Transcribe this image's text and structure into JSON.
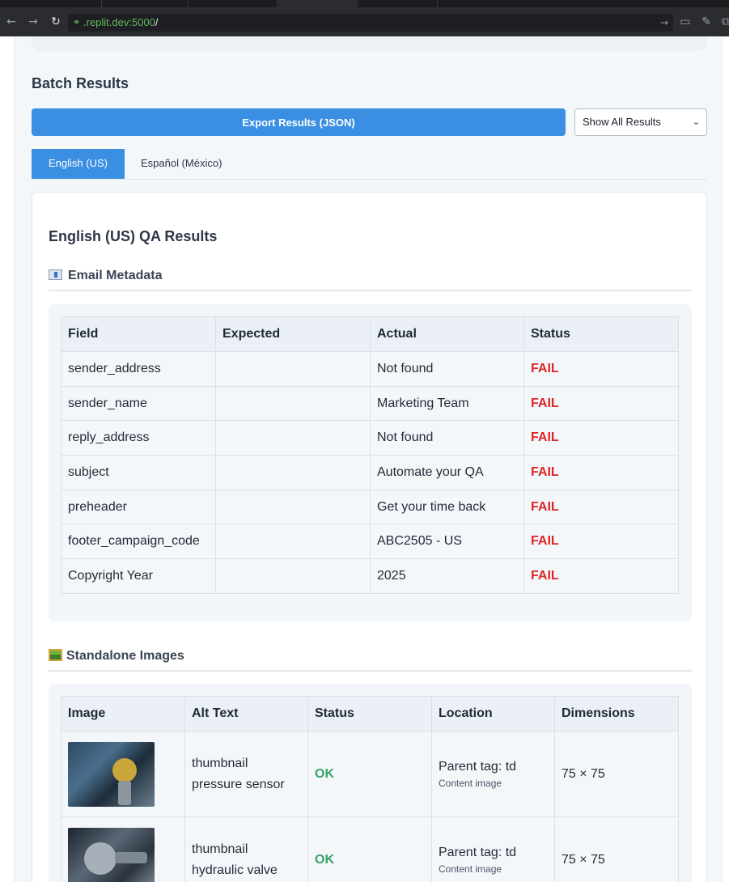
{
  "browser": {
    "url_host": ".replit.dev:5000",
    "url_path": "/"
  },
  "batch": {
    "title": "Batch Results",
    "export_label": "Export Results (JSON)",
    "filter_selected": "Show All Results",
    "tabs": [
      {
        "label": "English (US)",
        "active": true
      },
      {
        "label": "Español (México)",
        "active": false
      }
    ]
  },
  "results": {
    "title": "English (US) QA Results",
    "metadata": {
      "title": "Email Metadata",
      "headers": [
        "Field",
        "Expected",
        "Actual",
        "Status"
      ],
      "rows": [
        {
          "field": "sender_address",
          "expected": "",
          "actual": "Not found",
          "status": "FAIL"
        },
        {
          "field": "sender_name",
          "expected": "",
          "actual": "Marketing Team",
          "status": "FAIL"
        },
        {
          "field": "reply_address",
          "expected": "",
          "actual": "Not found",
          "status": "FAIL"
        },
        {
          "field": "subject",
          "expected": "",
          "actual": "Automate your QA",
          "status": "FAIL"
        },
        {
          "field": "preheader",
          "expected": "",
          "actual": "Get your time back",
          "status": "FAIL"
        },
        {
          "field": "footer_campaign_code",
          "expected": "",
          "actual": "ABC2505 - US",
          "status": "FAIL"
        },
        {
          "field": "Copyright Year",
          "expected": "",
          "actual": "2025",
          "status": "FAIL"
        }
      ]
    },
    "images": {
      "title": "Standalone Images",
      "headers": [
        "Image",
        "Alt Text",
        "Status",
        "Location",
        "Dimensions"
      ],
      "rows": [
        {
          "alt_line1": "thumbnail",
          "alt_line2": "pressure sensor",
          "status": "OK",
          "location": "Parent tag: td",
          "location_sub": "Content image",
          "dimensions": "75 × 75"
        },
        {
          "alt_line1": "thumbnail",
          "alt_line2": "hydraulic valve",
          "status": "OK",
          "location": "Parent tag: td",
          "location_sub": "Content image",
          "dimensions": "75 × 75"
        }
      ]
    }
  },
  "colors": {
    "accent": "#3b8fe2",
    "fail": "#dc2626",
    "ok": "#38a169"
  }
}
